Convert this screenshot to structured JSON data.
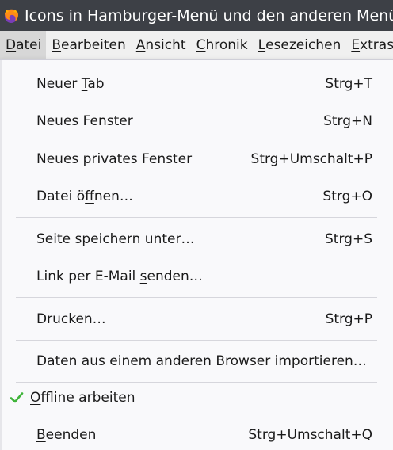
{
  "window": {
    "title": "Icons in Hamburger-Menü und den anderen Menüs ein",
    "app_icon": "firefox-icon"
  },
  "menubar": {
    "items": [
      {
        "label": "Datei",
        "accel_index": 0,
        "active": true
      },
      {
        "label": "Bearbeiten",
        "accel_index": 0,
        "active": false
      },
      {
        "label": "Ansicht",
        "accel_index": 0,
        "active": false
      },
      {
        "label": "Chronik",
        "accel_index": 0,
        "active": false
      },
      {
        "label": "Lesezeichen",
        "accel_index": 0,
        "active": false
      },
      {
        "label": "Extras",
        "accel_index": 0,
        "active": false
      }
    ]
  },
  "file_menu": {
    "items": [
      {
        "pre": "Neuer ",
        "key": "T",
        "post": "ab",
        "shortcut": "Strg+T"
      },
      {
        "pre": "",
        "key": "N",
        "post": "eues Fenster",
        "shortcut": "Strg+N"
      },
      {
        "pre": "Neues ",
        "key": "p",
        "post": "rivates Fenster",
        "shortcut": "Strg+Umschalt+P"
      },
      {
        "pre": "Datei ö",
        "key": "f",
        "post": "fnen…",
        "shortcut": "Strg+O"
      },
      {
        "pre": "Seite speichern ",
        "key": "u",
        "post": "nter…",
        "shortcut": "Strg+S"
      },
      {
        "pre": "Link per E-Mail ",
        "key": "s",
        "post": "enden…",
        "shortcut": ""
      },
      {
        "pre": "",
        "key": "D",
        "post": "rucken…",
        "shortcut": "Strg+P"
      },
      {
        "pre": "Daten aus einem ande",
        "key": "r",
        "post": "en Browser importieren…",
        "shortcut": ""
      },
      {
        "pre": "",
        "key": "O",
        "post": "ffline arbeiten",
        "shortcut": "",
        "checked": true,
        "check_icon": "checkmark-icon"
      },
      {
        "pre": "",
        "key": "B",
        "post": "eenden",
        "shortcut": "Strg+Umschalt+Q"
      }
    ]
  },
  "colors": {
    "titlebar_bg": "#3d4046",
    "menu_bg": "#f9f9fb",
    "menubar_active_bg": "#d7d7d7",
    "check_green": "#3fb43a"
  }
}
